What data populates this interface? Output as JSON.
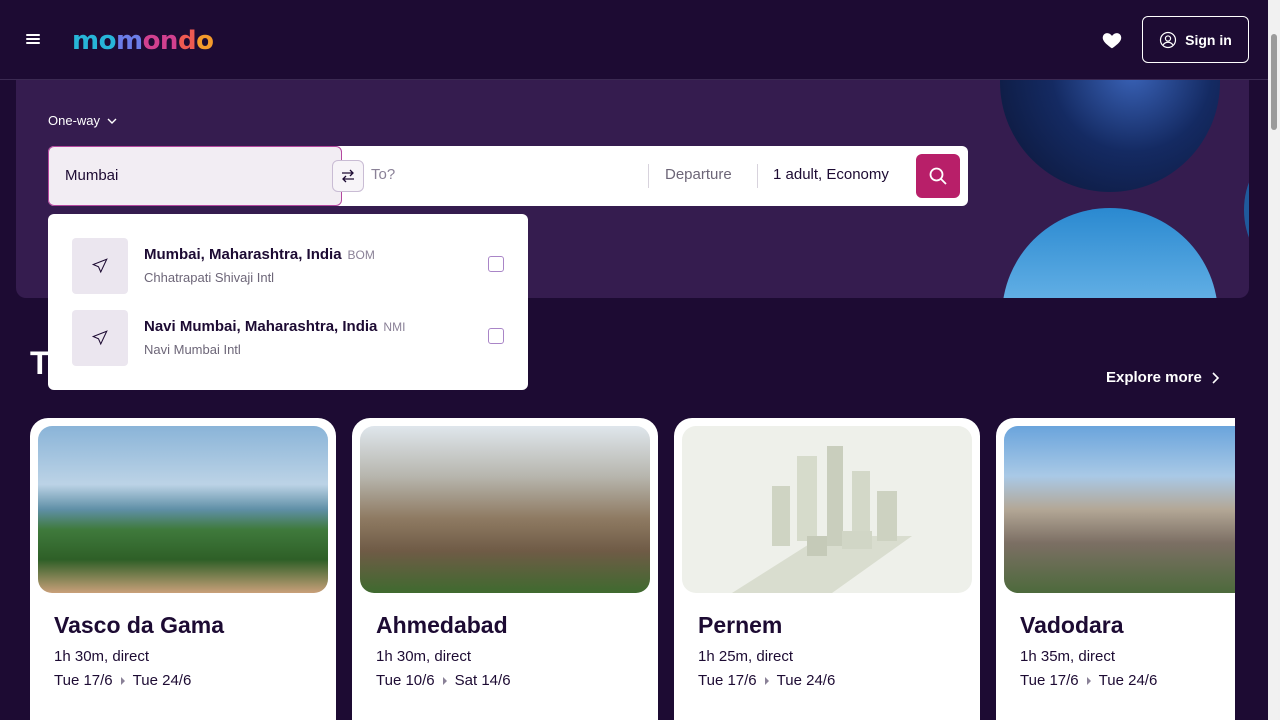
{
  "header": {
    "logo_parts": [
      "mo",
      "m",
      "on",
      "d",
      "o"
    ],
    "signin_label": "Sign in"
  },
  "search": {
    "trip_type": "One-way",
    "origin_value": "Mumbai",
    "destination_placeholder": "To?",
    "departure_label": "Departure",
    "travellers_label": "1 adult, Economy"
  },
  "suggestions": [
    {
      "name": "Mumbai, Maharashtra, India",
      "code": "BOM",
      "airport": "Chhatrapati Shivaji Intl"
    },
    {
      "name": "Navi Mumbai, Maharashtra, India",
      "code": "NMI",
      "airport": "Navi Mumbai Intl"
    }
  ],
  "section": {
    "title_fragment": "T",
    "explore_label": "Explore more"
  },
  "cards": [
    {
      "city": "Vasco da Gama",
      "duration": "1h 30m, direct",
      "depart": "Tue 17/6",
      "return": "Tue 24/6"
    },
    {
      "city": "Ahmedabad",
      "duration": "1h 30m, direct",
      "depart": "Tue 10/6",
      "return": "Sat 14/6"
    },
    {
      "city": "Pernem",
      "duration": "1h 25m, direct",
      "depart": "Tue 17/6",
      "return": "Tue 24/6"
    },
    {
      "city": "Vadodara",
      "duration": "1h 35m, direct",
      "depart": "Tue 17/6",
      "return": "Tue 24/6"
    }
  ],
  "colors": {
    "background": "#1d0b33",
    "hero": "#351c4f",
    "accent": "#b81f69"
  }
}
